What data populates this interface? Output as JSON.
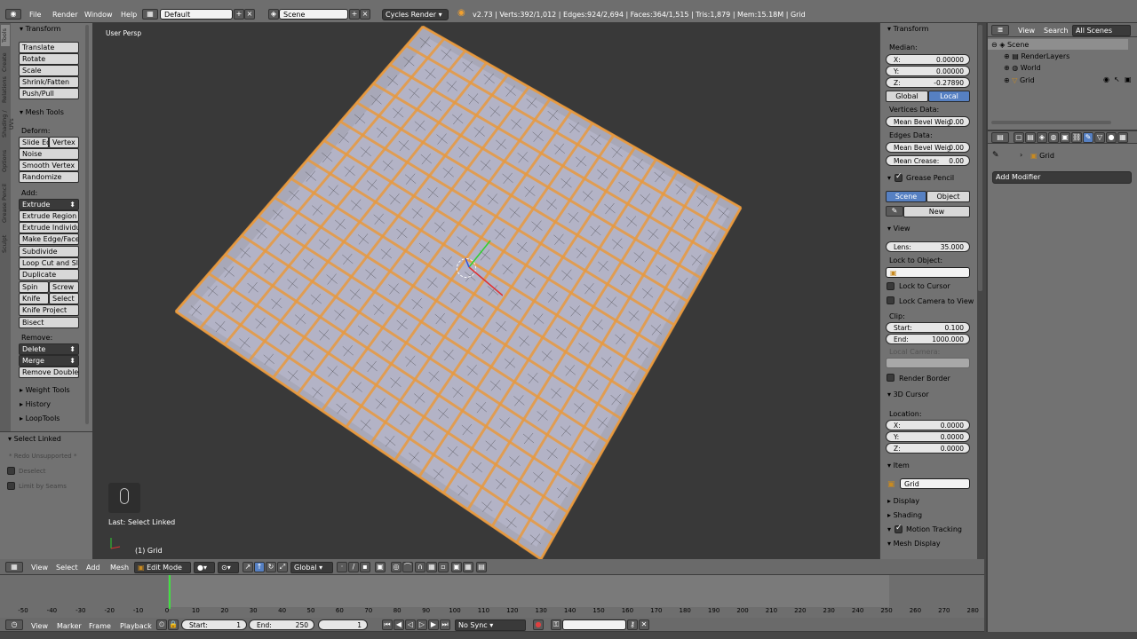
{
  "top_bar": {
    "menu": [
      "File",
      "Render",
      "Window",
      "Help"
    ],
    "layout": "Default",
    "scene": "Scene",
    "engine": "Cycles Render",
    "stats": "v2.73 | Verts:392/1,012 | Edges:924/2,694 | Faces:364/1,515 | Tris:1,879 | Mem:15.18M | Grid"
  },
  "tool_tabs": [
    "Tools",
    "Create",
    "Relations",
    "Shading / UVs",
    "Options",
    "Grease Pencil",
    "Sculpt"
  ],
  "tools": {
    "transform_header": "Transform",
    "transform": [
      "Translate",
      "Rotate",
      "Scale",
      "Shrink/Fatten",
      "Push/Pull"
    ],
    "mesh_tools_header": "Mesh Tools",
    "deform_label": "Deform:",
    "slide_edge": "Slide Ed",
    "vertex": "Vertex",
    "deform": [
      "Noise",
      "Smooth Vertex",
      "Randomize"
    ],
    "add_label": "Add:",
    "extrude": "Extrude",
    "add": [
      "Extrude Region",
      "Extrude Individual",
      "Make Edge/Face",
      "Subdivide",
      "Loop Cut and Slide",
      "Duplicate"
    ],
    "spin": "Spin",
    "screw": "Screw",
    "knife": "Knife",
    "select": "Select",
    "knife_project": "Knife Project",
    "bisect": "Bisect",
    "remove_label": "Remove:",
    "delete": "Delete",
    "merge": "Merge",
    "remove_doubles": "Remove Doubles",
    "collapsed": [
      "Weight Tools",
      "History",
      "LoopTools"
    ]
  },
  "operator": {
    "header": "Select Linked",
    "redo": "* Redo Unsupported *",
    "deselect": "Deselect",
    "limit_seams": "Limit by Seams"
  },
  "viewport": {
    "view_name": "User Persp",
    "last_op": "Last: Select Linked",
    "object": "(1) Grid"
  },
  "properties": {
    "transform": {
      "header": "Transform",
      "median": "Median:",
      "x_label": "X:",
      "x": "0.00000",
      "y_label": "Y:",
      "y": "0.00000",
      "z_label": "Z:",
      "z": "-0.27890",
      "global": "Global",
      "local": "Local"
    },
    "vertices_data": "Vertices Data:",
    "vert_bevel": "Mean Bevel Weig",
    "vert_bevel_val": "0.00",
    "edges_data": "Edges Data:",
    "edge_bevel": "Mean Bevel Weig",
    "edge_bevel_val": "0.00",
    "crease": "Mean Crease:",
    "crease_val": "0.00",
    "grease": {
      "header": "Grease Pencil",
      "scene": "Scene",
      "object": "Object",
      "new": "New"
    },
    "view": {
      "header": "View",
      "lens_label": "Lens:",
      "lens": "35.000",
      "lock_obj": "Lock to Object:",
      "lock_cursor": "Lock to Cursor",
      "lock_cam": "Lock Camera to View",
      "clip": "Clip:",
      "start_label": "Start:",
      "start": "0.100",
      "end_label": "End:",
      "end": "1000.000",
      "local_cam": "Local Camera:",
      "render_border": "Render Border"
    },
    "cursor": {
      "header": "3D Cursor",
      "location": "Location:",
      "x_label": "X:",
      "x": "0.0000",
      "y_label": "Y:",
      "y": "0.0000",
      "z_label": "Z:",
      "z": "0.0000"
    },
    "item": {
      "header": "Item",
      "name": "Grid"
    },
    "collapsed": [
      "Display",
      "Shading"
    ],
    "motion_tracking": "Motion Tracking",
    "mesh_display": "Mesh Display"
  },
  "outliner": {
    "view": "View",
    "search": "Search",
    "all_scenes": "All Scenes",
    "items": [
      "Scene",
      "RenderLayers",
      "World",
      "Grid"
    ]
  },
  "modifiers": {
    "object": "Grid",
    "add_modifier": "Add Modifier"
  },
  "view3d_header": {
    "view": "View",
    "select": "Select",
    "add": "Add",
    "mesh": "Mesh",
    "mode": "Edit Mode",
    "orientation": "Global"
  },
  "timeline": {
    "ticks": [
      "-50",
      "-40",
      "-30",
      "-20",
      "-10",
      "0",
      "10",
      "20",
      "30",
      "40",
      "50",
      "60",
      "70",
      "80",
      "90",
      "100",
      "110",
      "120",
      "130",
      "140",
      "150",
      "160",
      "170",
      "180",
      "190",
      "200",
      "210",
      "220",
      "230",
      "240",
      "250",
      "260",
      "270",
      "280"
    ],
    "view": "View",
    "marker": "Marker",
    "frame": "Frame",
    "playback": "Playback",
    "start_label": "Start:",
    "start": "1",
    "end_label": "End:",
    "end": "250",
    "current": "1",
    "sync": "No Sync"
  }
}
